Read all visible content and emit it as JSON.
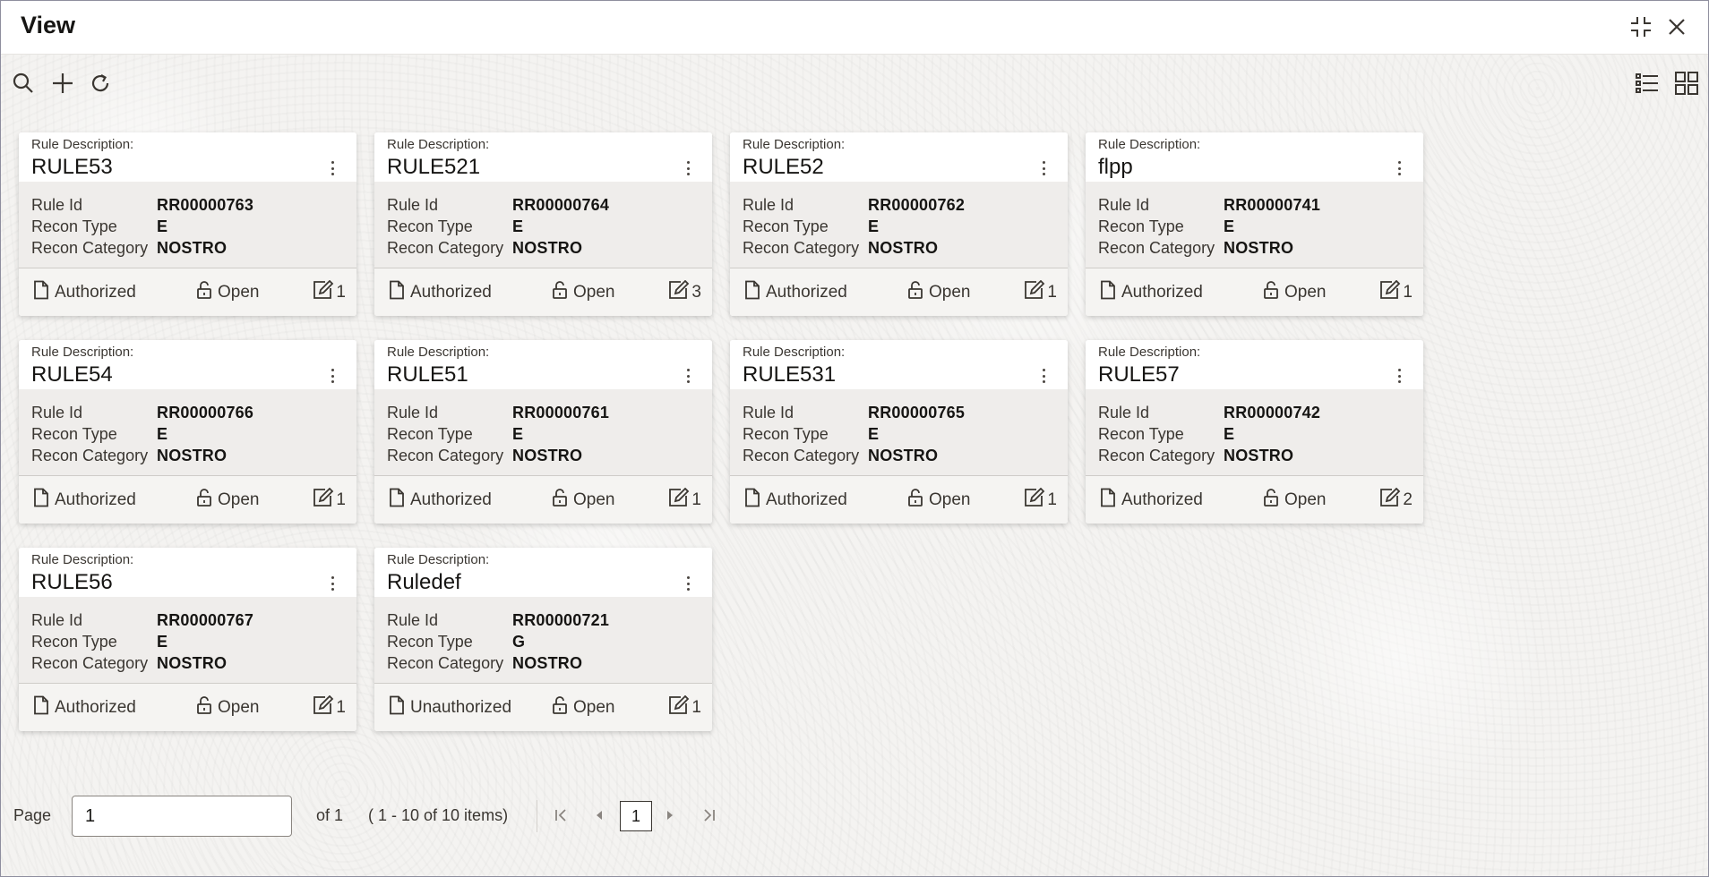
{
  "window": {
    "title": "View"
  },
  "toolbar": {
    "icons": [
      "search-icon",
      "add-icon",
      "refresh-icon",
      "list-view-icon",
      "grid-view-icon"
    ]
  },
  "cards": [
    {
      "desc_label": "Rule Description:",
      "desc": "RULE53",
      "rule_id_label": "Rule Id",
      "rule_id": "RR00000763",
      "recon_type_label": "Recon Type",
      "recon_type": "E",
      "recon_category_label": "Recon Category",
      "recon_category": "NOSTRO",
      "status": "Authorized",
      "lock": "Open",
      "mods": "1"
    },
    {
      "desc_label": "Rule Description:",
      "desc": "RULE521",
      "rule_id_label": "Rule Id",
      "rule_id": "RR00000764",
      "recon_type_label": "Recon Type",
      "recon_type": "E",
      "recon_category_label": "Recon Category",
      "recon_category": "NOSTRO",
      "status": "Authorized",
      "lock": "Open",
      "mods": "3"
    },
    {
      "desc_label": "Rule Description:",
      "desc": "RULE52",
      "rule_id_label": "Rule Id",
      "rule_id": "RR00000762",
      "recon_type_label": "Recon Type",
      "recon_type": "E",
      "recon_category_label": "Recon Category",
      "recon_category": "NOSTRO",
      "status": "Authorized",
      "lock": "Open",
      "mods": "1"
    },
    {
      "desc_label": "Rule Description:",
      "desc": "flpp",
      "rule_id_label": "Rule Id",
      "rule_id": "RR00000741",
      "recon_type_label": "Recon Type",
      "recon_type": "E",
      "recon_category_label": "Recon Category",
      "recon_category": "NOSTRO",
      "status": "Authorized",
      "lock": "Open",
      "mods": "1"
    },
    {
      "desc_label": "Rule Description:",
      "desc": "RULE54",
      "rule_id_label": "Rule Id",
      "rule_id": "RR00000766",
      "recon_type_label": "Recon Type",
      "recon_type": "E",
      "recon_category_label": "Recon Category",
      "recon_category": "NOSTRO",
      "status": "Authorized",
      "lock": "Open",
      "mods": "1"
    },
    {
      "desc_label": "Rule Description:",
      "desc": "RULE51",
      "rule_id_label": "Rule Id",
      "rule_id": "RR00000761",
      "recon_type_label": "Recon Type",
      "recon_type": "E",
      "recon_category_label": "Recon Category",
      "recon_category": "NOSTRO",
      "status": "Authorized",
      "lock": "Open",
      "mods": "1"
    },
    {
      "desc_label": "Rule Description:",
      "desc": "RULE531",
      "rule_id_label": "Rule Id",
      "rule_id": "RR00000765",
      "recon_type_label": "Recon Type",
      "recon_type": "E",
      "recon_category_label": "Recon Category",
      "recon_category": "NOSTRO",
      "status": "Authorized",
      "lock": "Open",
      "mods": "1"
    },
    {
      "desc_label": "Rule Description:",
      "desc": "RULE57",
      "rule_id_label": "Rule Id",
      "rule_id": "RR00000742",
      "recon_type_label": "Recon Type",
      "recon_type": "E",
      "recon_category_label": "Recon Category",
      "recon_category": "NOSTRO",
      "status": "Authorized",
      "lock": "Open",
      "mods": "2"
    },
    {
      "desc_label": "Rule Description:",
      "desc": "RULE56",
      "rule_id_label": "Rule Id",
      "rule_id": "RR00000767",
      "recon_type_label": "Recon Type",
      "recon_type": "E",
      "recon_category_label": "Recon Category",
      "recon_category": "NOSTRO",
      "status": "Authorized",
      "lock": "Open",
      "mods": "1"
    },
    {
      "desc_label": "Rule Description:",
      "desc": "Ruledef",
      "rule_id_label": "Rule Id",
      "rule_id": "RR00000721",
      "recon_type_label": "Recon Type",
      "recon_type": "G",
      "recon_category_label": "Recon Category",
      "recon_category": "NOSTRO",
      "status": "Unauthorized",
      "lock": "Open",
      "mods": "1"
    }
  ],
  "pager": {
    "page_label": "Page",
    "page_value": "1",
    "of_label": "of 1",
    "items_label": "( 1 - 10 of 10 items)",
    "current_page": "1"
  }
}
